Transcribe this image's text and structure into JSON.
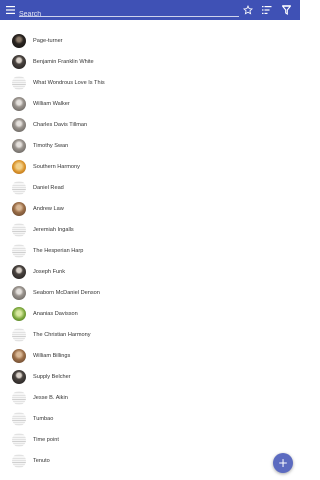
{
  "toolbar": {
    "accent": "#3f51b5",
    "menu_icon": "hamburger-menu-icon",
    "search_placeholder": "Search",
    "icons": [
      "star-icon",
      "sort-icon",
      "filter-icon"
    ]
  },
  "list": {
    "items": [
      {
        "label": "Page-turner",
        "avatar": "dark"
      },
      {
        "label": "Benjamin Franklin White",
        "avatar": "portrait-dark"
      },
      {
        "label": "What Wondrous Love Is This",
        "avatar": "sheet-music"
      },
      {
        "label": "William Walker",
        "avatar": "portrait-gray"
      },
      {
        "label": "Charles Davis Tillman",
        "avatar": "portrait-gray"
      },
      {
        "label": "Timothy Swan",
        "avatar": "portrait-gray"
      },
      {
        "label": "Southern Harmony",
        "avatar": "book-orange"
      },
      {
        "label": "Daniel Read",
        "avatar": "sheet-music"
      },
      {
        "label": "Andrew Law",
        "avatar": "portrait-brown"
      },
      {
        "label": "Jeremiah Ingalls",
        "avatar": "sheet-music"
      },
      {
        "label": "The Hesperian Harp",
        "avatar": "sheet-music"
      },
      {
        "label": "Joseph Funk",
        "avatar": "portrait-dark"
      },
      {
        "label": "Seaborn McDaniel Denson",
        "avatar": "portrait-gray"
      },
      {
        "label": "Ananias Davisson",
        "avatar": "green"
      },
      {
        "label": "The Christian Harmony",
        "avatar": "sheet-music"
      },
      {
        "label": "William Billings",
        "avatar": "portrait-brown"
      },
      {
        "label": "Supply Belcher",
        "avatar": "portrait-dark"
      },
      {
        "label": "Jesse B. Aikin",
        "avatar": "sheet-music"
      },
      {
        "label": "Tumbao",
        "avatar": "sheet-music"
      },
      {
        "label": "Time point",
        "avatar": "sheet-music"
      },
      {
        "label": "Tenuto",
        "avatar": "sheet-music"
      }
    ]
  },
  "fab": {
    "icon": "plus-icon",
    "color": "#5c6bc0",
    "symbol": "+"
  }
}
